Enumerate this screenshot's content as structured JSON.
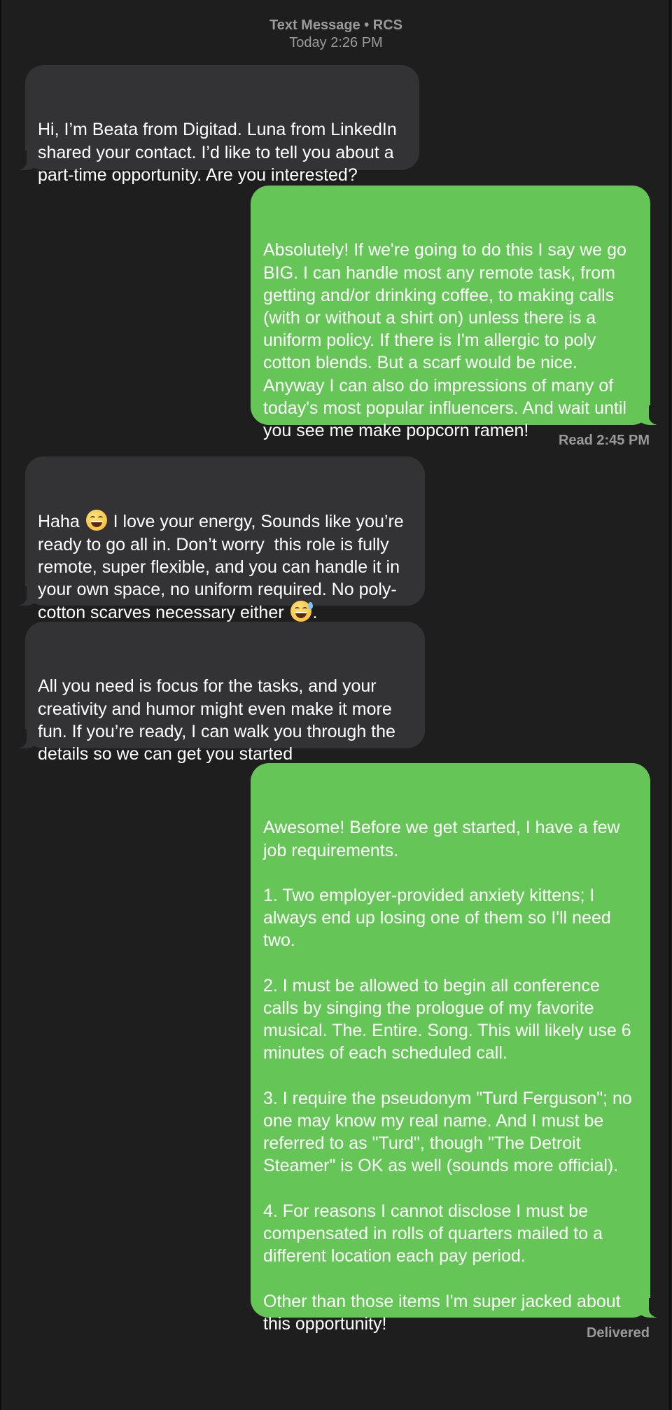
{
  "header": {
    "service": "Text Message • RCS",
    "time": "Today 2:26 PM"
  },
  "messages": [
    {
      "direction": "incoming",
      "text": "Hi, I’m Beata from Digitad. Luna from LinkedIn shared your contact. I’d like to tell you about a part-time opportunity. Are you interested?"
    },
    {
      "direction": "outgoing",
      "text": "Absolutely! If we're going to do this I say we go BIG. I can handle most any remote task, from getting and/or drinking coffee, to making calls (with or without a shirt on) unless there is a uniform policy. If there is I'm allergic to poly cotton blends. But a scarf would be nice. Anyway I can also do impressions of many of today's most popular influencers. And wait until you see me make popcorn ramen!"
    },
    {
      "direction": "incoming",
      "text_a": "Haha ",
      "emoji_a": "grinning-face-emoji",
      "text_b": " I love your energy, Sounds like you’re ready to go all in. Don’t worry  this role is fully remote, super flexible, and you can handle it in your own space, no uniform required. No poly-cotton scarves necessary either ",
      "emoji_b": "grinning-sweat-emoji",
      "text_c": "."
    },
    {
      "direction": "incoming",
      "text": "All you need is focus for the tasks, and your creativity and humor might even make it more fun. If you’re ready, I can walk you through the details so we can get you started"
    },
    {
      "direction": "outgoing",
      "text": "Awesome! Before we get started, I have a few job requirements.\n\n1. Two employer-provided anxiety kittens; I always end up losing one of them so I'll need two.\n\n2. I must be allowed to begin all conference calls by singing the prologue of my favorite musical. The. Entire. Song. This will likely use 6 minutes of each scheduled call.\n\n3. I require the pseudonym \"Turd Ferguson\"; no one may know my real name. And I must be referred to as \"Turd\", though \"The Detroit Steamer\" is OK as well (sounds more official).\n\n4. For reasons I cannot disclose I must be compensated in rolls of quarters mailed to a different location each pay period.\n\nOther than those items I'm super jacked about this opportunity!"
    }
  ],
  "status": {
    "read": "Read 2:45 PM",
    "delivered": "Delivered"
  },
  "colors": {
    "background": "#1e1e1e",
    "incoming_bubble": "#333335",
    "outgoing_bubble": "#65c556",
    "meta_text": "#9a9a9a"
  }
}
